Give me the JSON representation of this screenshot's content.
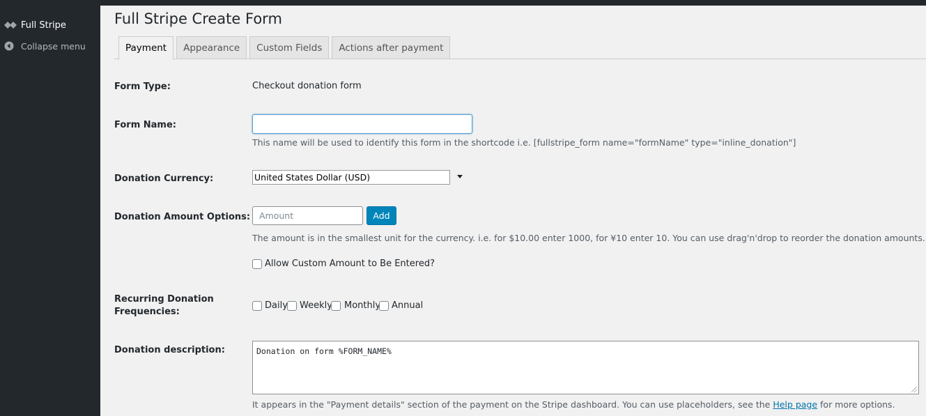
{
  "sidebar": {
    "active_item": "Full Stripe",
    "collapse_label": "Collapse menu",
    "icons": {
      "active": "full-stripe-icon",
      "collapse": "collapse-arrow-icon"
    }
  },
  "page": {
    "title": "Full Stripe Create Form",
    "tabs": [
      "Payment",
      "Appearance",
      "Custom Fields",
      "Actions after payment"
    ],
    "active_tab": "Payment"
  },
  "form": {
    "form_type": {
      "label": "Form Type:",
      "value": "Checkout donation form"
    },
    "form_name": {
      "label": "Form Name:",
      "value": "",
      "help": "This name will be used to identify this form in the shortcode i.e. [fullstripe_form name=\"formName\" type=\"inline_donation\"]"
    },
    "currency": {
      "label": "Donation Currency:",
      "selected": "United States Dollar (USD)"
    },
    "amount_options": {
      "label": "Donation Amount Options:",
      "placeholder": "Amount",
      "add_label": "Add",
      "help": "The amount is in the smallest unit for the currency. i.e. for $10.00 enter 1000, for ¥10 enter 10. You can use drag'n'drop to reorder the donation amounts.",
      "custom_amount_label": "Allow Custom Amount to Be Entered?"
    },
    "recurring": {
      "label_line1": "Recurring Donation",
      "label_line2": "Frequencies:",
      "options": [
        "Daily",
        "Weekly",
        "Monthly",
        "Annual"
      ]
    },
    "description": {
      "label": "Donation description:",
      "value": "Donation on form %FORM_NAME%",
      "help_before": "It appears in the \"Payment details\" section of the payment on the Stripe dashboard. You can use placeholders, see the ",
      "help_link": "Help page",
      "help_after": " for more options."
    }
  },
  "colors": {
    "sidebar_bg": "#23282d",
    "page_bg": "#f1f1f1",
    "button_primary": "#0085ba",
    "link": "#0073aa"
  }
}
